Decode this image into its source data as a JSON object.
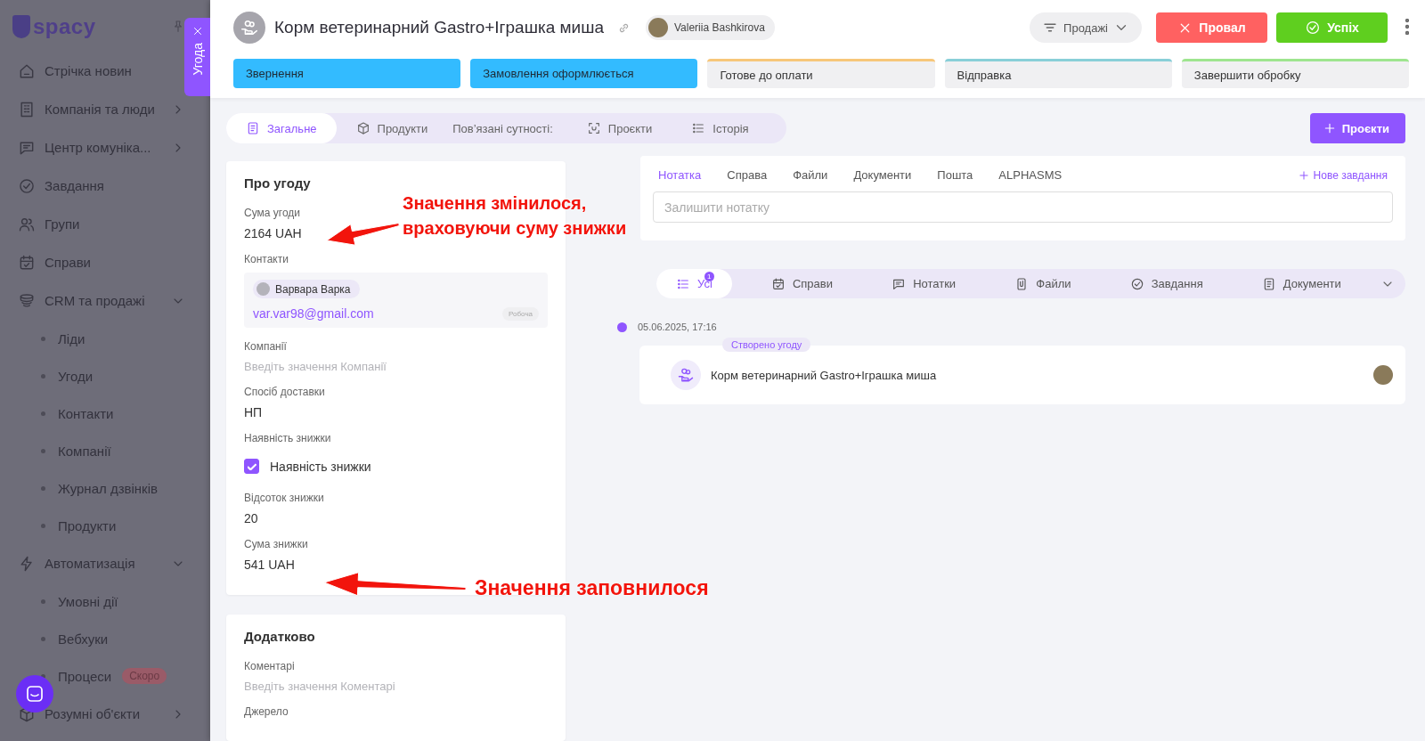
{
  "sidebar": {
    "logo": "spacy",
    "items": [
      {
        "label": "Стрічка новин"
      },
      {
        "label": "Компанія та люди",
        "expanded": false
      },
      {
        "label": "Центр комуніка...",
        "expanded": false
      },
      {
        "label": "Завдання"
      },
      {
        "label": "Групи"
      },
      {
        "label": "Справи"
      },
      {
        "label": "CRM та продажі",
        "expanded": true,
        "children": [
          {
            "label": "Ліди"
          },
          {
            "label": "Угоди"
          },
          {
            "label": "Контакти"
          },
          {
            "label": "Компанії"
          },
          {
            "label": "Журнал дзвінків"
          },
          {
            "label": "Продукти"
          }
        ]
      },
      {
        "label": "Автоматизація",
        "expanded": true,
        "children": [
          {
            "label": "Умовні дії"
          },
          {
            "label": "Вебхуки"
          },
          {
            "label": "Процеси",
            "badge": "Скоро"
          }
        ]
      },
      {
        "label": "Розумні об'єкти",
        "expanded": false
      }
    ]
  },
  "side_tab": {
    "label": "Угода"
  },
  "header": {
    "title": "Корм ветеринарний Gastro+Іграшка миша",
    "owner": "Valeriia Bashkirova",
    "pipeline": "Продажі",
    "fail_button": "Провал",
    "success_button": "Успіх"
  },
  "stages": [
    {
      "label": "Звернення",
      "passed": true,
      "color": "#33bbff"
    },
    {
      "label": "Замовлення оформлюється",
      "passed": true,
      "color": "#33bbff"
    },
    {
      "label": "Готове до оплати",
      "passed": false,
      "color": "#f7c77a"
    },
    {
      "label": "Відправка",
      "passed": false,
      "color": "#89cfd8"
    },
    {
      "label": "Завершити обробку",
      "passed": false,
      "color": "#9ee58f"
    }
  ],
  "tabs": [
    {
      "label": "Загальне",
      "selected": true
    },
    {
      "label": "Продукти",
      "selected": false
    },
    {
      "label": "Пов’язані сутності:",
      "kind": "caption"
    },
    {
      "label": "Проєкти",
      "selected": false
    },
    {
      "label": "Історія",
      "selected": false
    }
  ],
  "add_button": "Проєкти",
  "cards": [
    {
      "title": "Про угоду",
      "fields": [
        {
          "label": "Сума угоди",
          "kind": "text",
          "value": "2164 UAH"
        },
        {
          "label": "Контакти",
          "kind": "contact",
          "name": "Варвара Варка",
          "email": "var.var98@gmail.com",
          "email_type": "Робоча"
        },
        {
          "label": "Компанії",
          "kind": "text",
          "placeholder": "Введіть значення Компанії"
        },
        {
          "label": "Спосіб доставки",
          "kind": "text",
          "value": "НП"
        },
        {
          "label": "Наявність знижки",
          "kind": "checkbox",
          "checked": true,
          "text": "Наявність знижки"
        },
        {
          "label": "Відсоток знижки",
          "kind": "text",
          "value": "20"
        },
        {
          "label": "Сума знижки",
          "kind": "text",
          "value": "541 UAH"
        }
      ]
    },
    {
      "title": "Додатково",
      "fields": [
        {
          "label": "Коментарі",
          "kind": "text",
          "placeholder": "Введіть значення Коментарі"
        },
        {
          "label": "Джерело",
          "kind": "text"
        }
      ]
    }
  ],
  "composer": {
    "tabs": [
      {
        "label": "Нотатка",
        "selected": true
      },
      {
        "label": "Справа",
        "selected": false
      },
      {
        "label": "Файли",
        "selected": false
      },
      {
        "label": "Документи",
        "selected": false
      },
      {
        "label": "Пошта",
        "selected": false
      },
      {
        "label": "ALPHASMS",
        "selected": false
      }
    ],
    "action": "Нове завдання",
    "placeholder": "Залишити нотатку"
  },
  "filters": [
    {
      "label": "Усі",
      "selected": true,
      "badge": "1"
    },
    {
      "label": "Справи",
      "selected": false
    },
    {
      "label": "Нотатки",
      "selected": false
    },
    {
      "label": "Файли",
      "selected": false
    },
    {
      "label": "Завдання",
      "selected": false
    },
    {
      "label": "Документи",
      "selected": false
    }
  ],
  "timeline": [
    {
      "date": "05.06.2025, 17:16",
      "tag": "Створено угоду",
      "title": "Корм ветеринарний Gastro+Іграшка миша"
    }
  ],
  "annotations": [
    {
      "lines": [
        "Значення змінилося,",
        "враховуючи суму знижки"
      ]
    },
    {
      "lines": [
        "Значення заповнилося"
      ]
    }
  ]
}
